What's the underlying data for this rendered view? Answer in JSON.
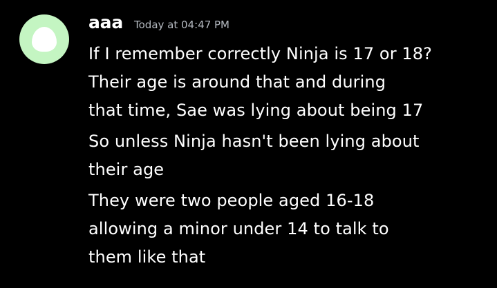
{
  "message": {
    "author": "aaa",
    "timestamp": "Today at 04:47 PM",
    "avatar_color": "#c4f5c2",
    "lines": [
      "If I remember correctly Ninja is 17 or 18?\nTheir age is around that and during\nthat time, Sae was lying about being 17",
      "So unless Ninja hasn't been lying about\ntheir age",
      "They were two people aged 16-18\nallowing a minor under 14 to talk to\nthem like that"
    ]
  }
}
